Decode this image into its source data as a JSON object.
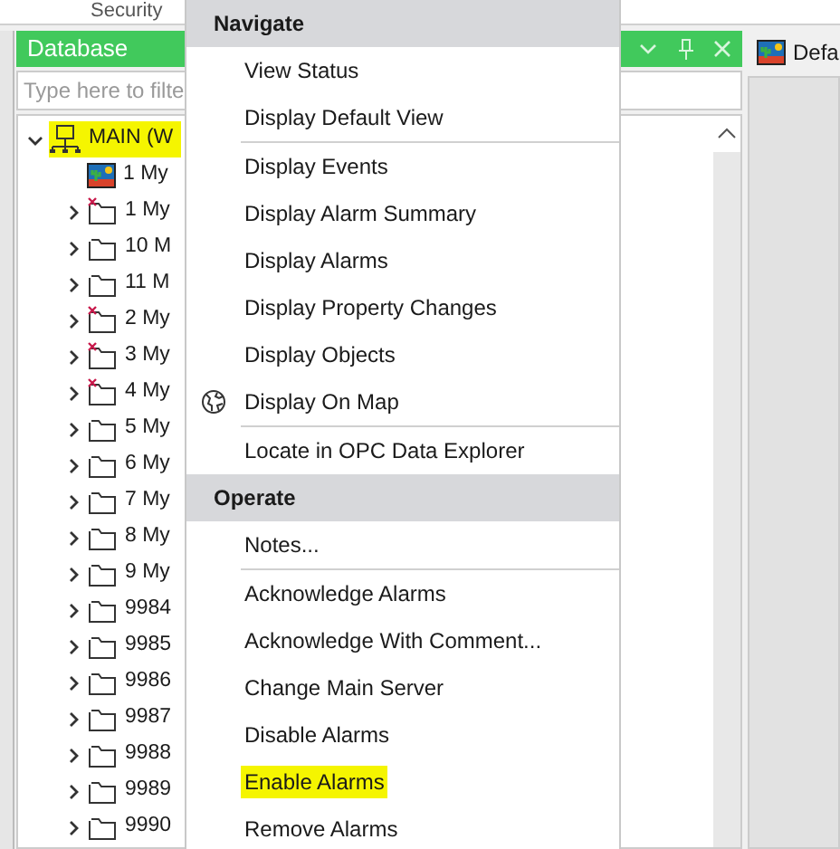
{
  "top_header": {
    "column": "Security"
  },
  "database_panel": {
    "title": "Database",
    "filter": {
      "placeholder": "Type here to filte"
    },
    "tree": [
      {
        "label": "MAIN (W",
        "kind": "server",
        "expanded": true,
        "highlighted": true,
        "children": [
          {
            "label": "1 My",
            "kind": "display",
            "highlighted": false
          },
          {
            "label": "1 My",
            "kind": "folder",
            "expanded": false,
            "marked": true,
            "highlighted": false
          },
          {
            "label": "10 M",
            "kind": "folder",
            "expanded": false,
            "marked": false,
            "highlighted": false
          },
          {
            "label": "11 M",
            "kind": "folder",
            "expanded": false,
            "marked": false,
            "highlighted": false
          },
          {
            "label": "2 My",
            "kind": "folder",
            "expanded": false,
            "marked": true,
            "highlighted": false
          },
          {
            "label": "3 My",
            "kind": "folder",
            "expanded": false,
            "marked": true,
            "highlighted": false
          },
          {
            "label": "4 My",
            "kind": "folder",
            "expanded": false,
            "marked": true,
            "highlighted": false
          },
          {
            "label": "5 My",
            "kind": "folder",
            "expanded": false,
            "marked": false,
            "highlighted": false
          },
          {
            "label": "6 My",
            "kind": "folder",
            "expanded": false,
            "marked": false,
            "highlighted": false
          },
          {
            "label": "7 My",
            "kind": "folder",
            "expanded": false,
            "marked": false,
            "highlighted": false
          },
          {
            "label": "8 My",
            "kind": "folder",
            "expanded": false,
            "marked": false,
            "highlighted": false
          },
          {
            "label": "9 My",
            "kind": "folder",
            "expanded": false,
            "marked": false,
            "highlighted": false
          },
          {
            "label": "9984",
            "kind": "folder",
            "expanded": false,
            "marked": false,
            "highlighted": false
          },
          {
            "label": "9985",
            "kind": "folder",
            "expanded": false,
            "marked": false,
            "highlighted": false
          },
          {
            "label": "9986",
            "kind": "folder",
            "expanded": false,
            "marked": false,
            "highlighted": false
          },
          {
            "label": "9987",
            "kind": "folder",
            "expanded": false,
            "marked": false,
            "highlighted": false
          },
          {
            "label": "9988",
            "kind": "folder",
            "expanded": false,
            "marked": false,
            "highlighted": false
          },
          {
            "label": "9989",
            "kind": "folder",
            "expanded": false,
            "marked": false,
            "highlighted": false
          },
          {
            "label": "9990",
            "kind": "folder",
            "expanded": false,
            "marked": false,
            "highlighted": false
          }
        ]
      }
    ]
  },
  "view_tab": {
    "label": "Defa"
  },
  "context_menu": {
    "sections": [
      {
        "title": "Navigate",
        "groups": [
          [
            {
              "label": "View Status",
              "kind": "item",
              "highlighted": false
            },
            {
              "label": "Display Default View",
              "kind": "item",
              "highlighted": false
            }
          ],
          [
            {
              "label": "Display Events",
              "kind": "item",
              "highlighted": false
            },
            {
              "label": "Display Alarm Summary",
              "kind": "item",
              "highlighted": false
            },
            {
              "label": "Display Alarms",
              "kind": "item",
              "highlighted": false
            },
            {
              "label": "Display Property Changes",
              "kind": "item",
              "highlighted": false
            },
            {
              "label": "Display Objects",
              "kind": "item",
              "highlighted": false
            },
            {
              "label": "Display On Map",
              "kind": "map",
              "highlighted": false
            }
          ],
          [
            {
              "label": "Locate in OPC Data Explorer",
              "kind": "item",
              "highlighted": false
            }
          ]
        ]
      },
      {
        "title": "Operate",
        "groups": [
          [
            {
              "label": "Notes...",
              "kind": "item",
              "highlighted": false
            }
          ],
          [
            {
              "label": "Acknowledge Alarms",
              "kind": "item",
              "highlighted": false
            },
            {
              "label": "Acknowledge With Comment...",
              "kind": "item",
              "highlighted": false
            },
            {
              "label": "Change Main Server",
              "kind": "item",
              "highlighted": false
            },
            {
              "label": "Disable Alarms",
              "kind": "item",
              "highlighted": false
            },
            {
              "label": "Enable Alarms",
              "kind": "item",
              "highlighted": true
            },
            {
              "label": "Remove Alarms",
              "kind": "item",
              "highlighted": false
            }
          ]
        ]
      }
    ]
  }
}
